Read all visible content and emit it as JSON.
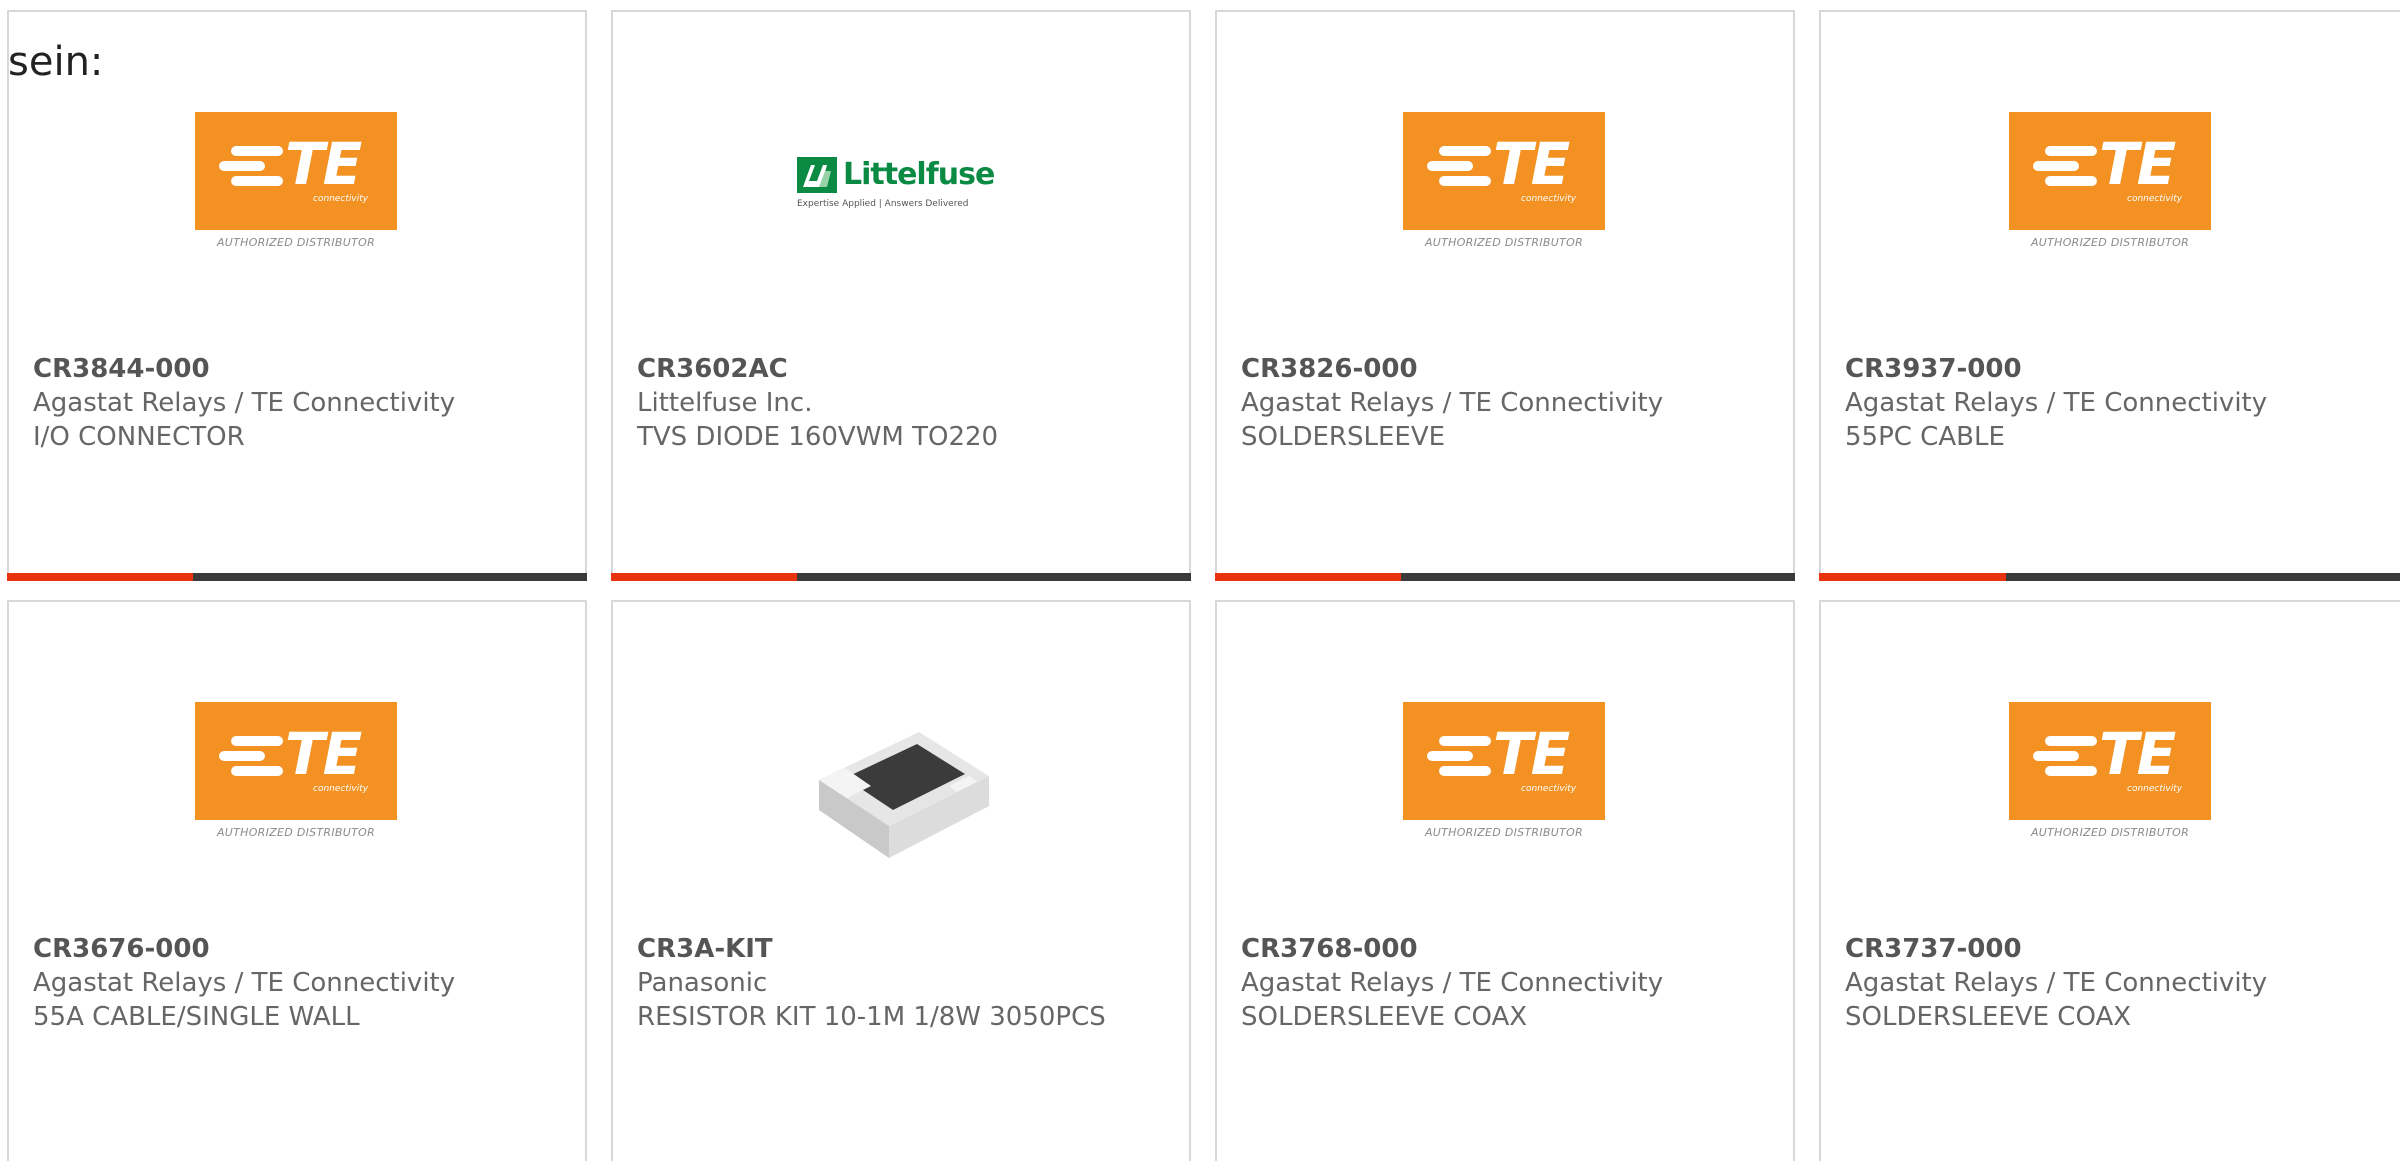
{
  "heading": "sein:",
  "colors": {
    "progress_fill": "#e8330e",
    "progress_track": "#3a3a3a",
    "te_orange": "#f39123",
    "littelfuse_green": "#0b8a44"
  },
  "logos": {
    "te": {
      "letters": "TE",
      "sub": "connectivity",
      "caption": "AUTHORIZED DISTRIBUTOR"
    },
    "littelfuse": {
      "name": "Littelfuse",
      "tagline": "Expertise Applied | Answers Delivered"
    }
  },
  "products": [
    {
      "part": "CR3844-000",
      "maker": "Agastat Relays / TE Connectivity",
      "desc": "I/O CONNECTOR",
      "image": "te-logo",
      "progress": 0.32
    },
    {
      "part": "CR3602AC",
      "maker": "Littelfuse Inc.",
      "desc": "TVS DIODE 160VWM TO220",
      "image": "littelfuse-logo",
      "progress": 0.32
    },
    {
      "part": "CR3826-000",
      "maker": "Agastat Relays / TE Connectivity",
      "desc": "SOLDERSLEEVE",
      "image": "te-logo",
      "progress": 0.32
    },
    {
      "part": "CR3937-000",
      "maker": "Agastat Relays / TE Connectivity",
      "desc": "55PC CABLE",
      "image": "te-logo",
      "progress": 0.32
    },
    {
      "part": "CR3676-000",
      "maker": "Agastat Relays / TE Connectivity",
      "desc": "55A CABLE/SINGLE WALL",
      "image": "te-logo"
    },
    {
      "part": "CR3A-KIT",
      "maker": "Panasonic",
      "desc": "RESISTOR KIT 10-1M 1/8W 3050PCS",
      "image": "resistor-chip"
    },
    {
      "part": "CR3768-000",
      "maker": "Agastat Relays / TE Connectivity",
      "desc": "SOLDERSLEEVE COAX",
      "image": "te-logo"
    },
    {
      "part": "CR3737-000",
      "maker": "Agastat Relays / TE Connectivity",
      "desc": "SOLDERSLEEVE COAX",
      "image": "te-logo"
    }
  ]
}
